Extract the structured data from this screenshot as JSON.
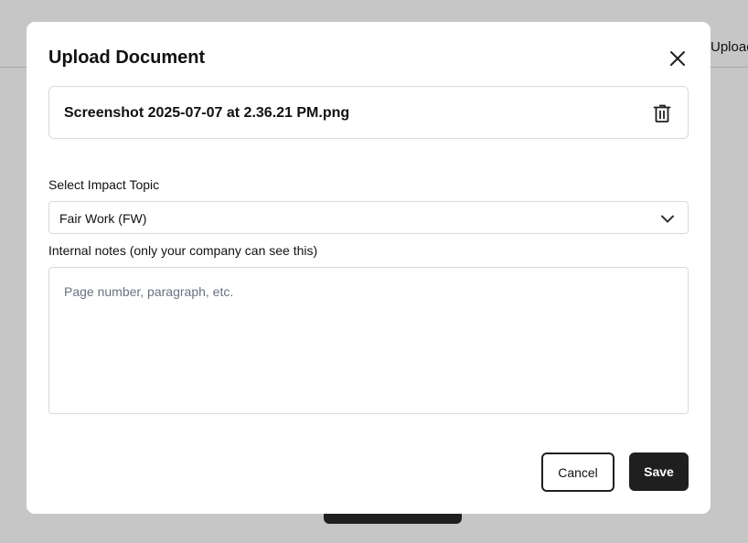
{
  "background": {
    "header_action_text": "Uploac"
  },
  "modal": {
    "title": "Upload Document",
    "close_icon": "close-icon",
    "file": {
      "name": "Screenshot 2025-07-07 at 2.36.21 PM.png",
      "delete_icon": "trash-icon"
    },
    "impact_topic": {
      "label": "Select Impact Topic",
      "selected": "Fair Work (FW)",
      "dropdown_icon": "chevron-down-icon"
    },
    "notes": {
      "label": "Internal notes (only your company can see this)",
      "placeholder": "Page number, paragraph, etc.",
      "value": ""
    },
    "actions": {
      "cancel_label": "Cancel",
      "save_label": "Save"
    }
  },
  "colors": {
    "overlay": "#c6c6c6",
    "primary_button": "#1f1f1f",
    "border": "#d9d9d9",
    "placeholder": "#6b7280"
  }
}
